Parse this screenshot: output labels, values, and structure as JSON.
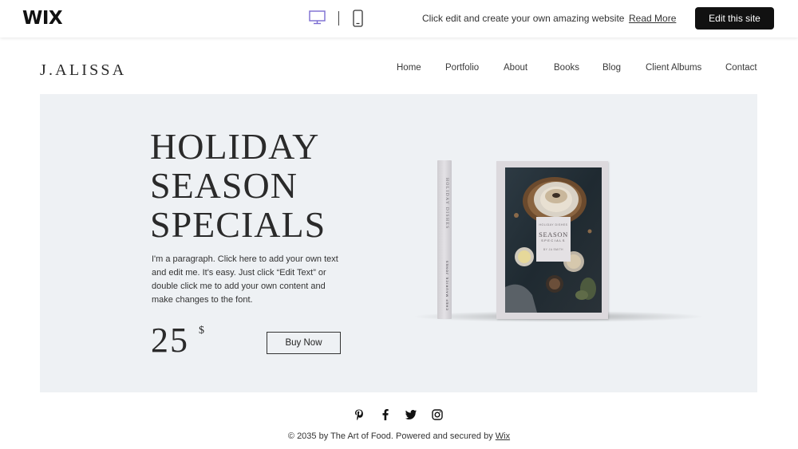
{
  "wix_bar": {
    "logo": "WIX",
    "message": "Click edit and create your own amazing website",
    "read_more": "Read More",
    "edit_button": "Edit this site",
    "devices": {
      "desktop_icon": "desktop-icon",
      "mobile_icon": "mobile-icon",
      "active": "desktop",
      "active_color": "#7b6bd1"
    }
  },
  "site": {
    "logo": "J.ALISSA",
    "nav": [
      "Home",
      "Portfolio",
      "About",
      "Books",
      "Blog",
      "Client Albums",
      "Contact"
    ]
  },
  "hero": {
    "title_lines": [
      "HOLIDAY",
      "SEASON",
      "SPECIALS"
    ],
    "paragraph": "I'm a paragraph. Click here to add your own text and edit me. It's easy. Just click “Edit Text” or double click me to add your own content and make changes to the font.",
    "price": "25",
    "currency": "$",
    "buy_button": "Buy Now",
    "background": "#eef1f4"
  },
  "book": {
    "spine_title": "HOLIDAY DISHES",
    "spine_author": "CHEF MAURICE JONES",
    "cover_small": "HOLIDAY DISHES",
    "cover_title": "SEASON",
    "cover_subtitle": "SPECIALS",
    "cover_author": "BY JA SMITH"
  },
  "footer": {
    "social": [
      "pinterest-icon",
      "facebook-icon",
      "twitter-icon",
      "instagram-icon"
    ],
    "copyright_prefix": "© 2035 by The Art of Food. Powered and secured by ",
    "copyright_link": "Wix"
  }
}
